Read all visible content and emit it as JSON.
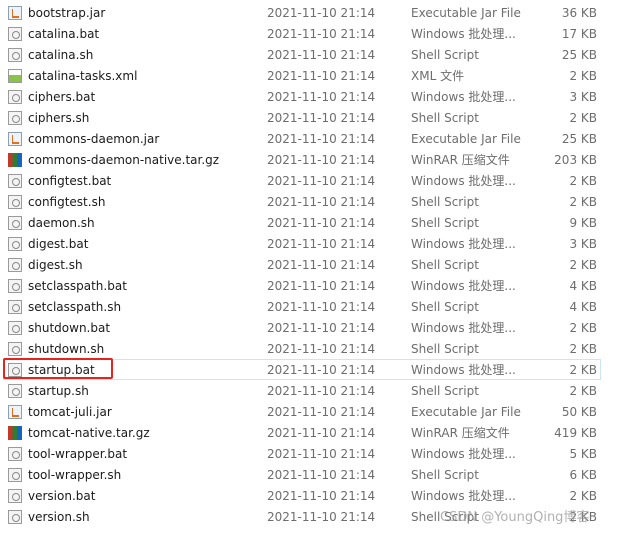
{
  "highlight_color": "#e8231e",
  "selected_index": 17,
  "files": [
    {
      "name": "bootstrap.jar",
      "date": "2021-11-10 21:14",
      "type": "Executable Jar File",
      "size": "36 KB",
      "icon": "jar"
    },
    {
      "name": "catalina.bat",
      "date": "2021-11-10 21:14",
      "type": "Windows 批处理...",
      "size": "17 KB",
      "icon": "bat"
    },
    {
      "name": "catalina.sh",
      "date": "2021-11-10 21:14",
      "type": "Shell Script",
      "size": "25 KB",
      "icon": "bat"
    },
    {
      "name": "catalina-tasks.xml",
      "date": "2021-11-10 21:14",
      "type": "XML 文件",
      "size": "2 KB",
      "icon": "xml"
    },
    {
      "name": "ciphers.bat",
      "date": "2021-11-10 21:14",
      "type": "Windows 批处理...",
      "size": "3 KB",
      "icon": "bat"
    },
    {
      "name": "ciphers.sh",
      "date": "2021-11-10 21:14",
      "type": "Shell Script",
      "size": "2 KB",
      "icon": "bat"
    },
    {
      "name": "commons-daemon.jar",
      "date": "2021-11-10 21:14",
      "type": "Executable Jar File",
      "size": "25 KB",
      "icon": "jar"
    },
    {
      "name": "commons-daemon-native.tar.gz",
      "date": "2021-11-10 21:14",
      "type": "WinRAR 压缩文件",
      "size": "203 KB",
      "icon": "rar"
    },
    {
      "name": "configtest.bat",
      "date": "2021-11-10 21:14",
      "type": "Windows 批处理...",
      "size": "2 KB",
      "icon": "bat"
    },
    {
      "name": "configtest.sh",
      "date": "2021-11-10 21:14",
      "type": "Shell Script",
      "size": "2 KB",
      "icon": "bat"
    },
    {
      "name": "daemon.sh",
      "date": "2021-11-10 21:14",
      "type": "Shell Script",
      "size": "9 KB",
      "icon": "bat"
    },
    {
      "name": "digest.bat",
      "date": "2021-11-10 21:14",
      "type": "Windows 批处理...",
      "size": "3 KB",
      "icon": "bat"
    },
    {
      "name": "digest.sh",
      "date": "2021-11-10 21:14",
      "type": "Shell Script",
      "size": "2 KB",
      "icon": "bat"
    },
    {
      "name": "setclasspath.bat",
      "date": "2021-11-10 21:14",
      "type": "Windows 批处理...",
      "size": "4 KB",
      "icon": "bat"
    },
    {
      "name": "setclasspath.sh",
      "date": "2021-11-10 21:14",
      "type": "Shell Script",
      "size": "4 KB",
      "icon": "bat"
    },
    {
      "name": "shutdown.bat",
      "date": "2021-11-10 21:14",
      "type": "Windows 批处理...",
      "size": "2 KB",
      "icon": "bat"
    },
    {
      "name": "shutdown.sh",
      "date": "2021-11-10 21:14",
      "type": "Shell Script",
      "size": "2 KB",
      "icon": "bat"
    },
    {
      "name": "startup.bat",
      "date": "2021-11-10 21:14",
      "type": "Windows 批处理...",
      "size": "2 KB",
      "icon": "bat"
    },
    {
      "name": "startup.sh",
      "date": "2021-11-10 21:14",
      "type": "Shell Script",
      "size": "2 KB",
      "icon": "bat"
    },
    {
      "name": "tomcat-juli.jar",
      "date": "2021-11-10 21:14",
      "type": "Executable Jar File",
      "size": "50 KB",
      "icon": "jar"
    },
    {
      "name": "tomcat-native.tar.gz",
      "date": "2021-11-10 21:14",
      "type": "WinRAR 压缩文件",
      "size": "419 KB",
      "icon": "rar"
    },
    {
      "name": "tool-wrapper.bat",
      "date": "2021-11-10 21:14",
      "type": "Windows 批处理...",
      "size": "5 KB",
      "icon": "bat"
    },
    {
      "name": "tool-wrapper.sh",
      "date": "2021-11-10 21:14",
      "type": "Shell Script",
      "size": "6 KB",
      "icon": "bat"
    },
    {
      "name": "version.bat",
      "date": "2021-11-10 21:14",
      "type": "Windows 批处理...",
      "size": "2 KB",
      "icon": "bat"
    },
    {
      "name": "version.sh",
      "date": "2021-11-10 21:14",
      "type": "Shell Script",
      "size": "2 KB",
      "icon": "bat"
    }
  ],
  "watermark": "CSDN @YoungQing博客"
}
